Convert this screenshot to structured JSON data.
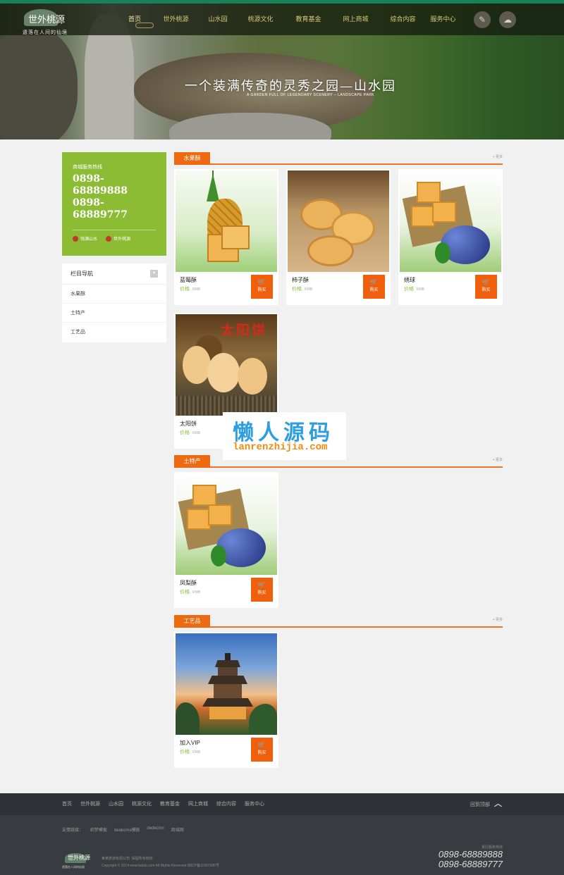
{
  "header": {
    "logo_name": "世外桃源",
    "logo_tagline": "遗落在人间的仙境",
    "nav": [
      "首页",
      "世外桃源",
      "山水园",
      "桃源文化",
      "教育基金",
      "网上商城",
      "综合内容",
      "服务中心"
    ],
    "active_nav": 0
  },
  "banner": {
    "slogan": "一个装满传奇的灵秀之园—山水园",
    "slogan_en": "A GARDEN FULL OF LEGENDARY SCENERY – LANDSCAPE PARK"
  },
  "sidebar": {
    "hotline_label": "商城服务热线",
    "hotline_numbers": [
      "0898-68889888",
      "0898-68889777"
    ],
    "hotline_links": [
      "钱满山水",
      "世外桃源"
    ],
    "category_title": "栏目导航",
    "categories": [
      "水果酥",
      "土特产",
      "工艺品"
    ]
  },
  "sections": [
    {
      "title": "水果酥",
      "more": "+ 更多",
      "items": [
        {
          "name": "蓝莓酥",
          "price_label": "价格",
          "currency": "RMB",
          "buy": "购买"
        },
        {
          "name": "柿子酥",
          "price_label": "价格",
          "currency": "RMB",
          "buy": "购买"
        },
        {
          "name": "绣球",
          "price_label": "价格",
          "currency": "RMB",
          "buy": "购买"
        },
        {
          "name": "太阳饼",
          "price_label": "价格",
          "currency": "RMB",
          "buy": "购买",
          "image_text": "太阳饼"
        }
      ]
    },
    {
      "title": "土特产",
      "more": "+ 更多",
      "items": [
        {
          "name": "凤梨酥",
          "price_label": "价格",
          "currency": "RMB",
          "buy": "购买"
        }
      ]
    },
    {
      "title": "工艺品",
      "more": "+ 更多",
      "items": [
        {
          "name": "加入VIP",
          "price_label": "价格",
          "currency": "RMB",
          "buy": "购买"
        }
      ]
    }
  ],
  "watermark": {
    "cn": "懒人源码",
    "en": "lanrenzhijia.com"
  },
  "footer": {
    "nav": [
      "首页",
      "世外桃源",
      "山水园",
      "桃源文化",
      "教育基金",
      "网上商城",
      "综合内容",
      "服务中心"
    ],
    "back_to_top": "回到顶部",
    "friends_label": "友情链接：",
    "friends": [
      "织梦模板",
      "dedecms模板",
      "dedecms",
      "商城网"
    ],
    "company": "某某旅游有限公司",
    "rights": "保留所有权权",
    "copyright": "Copyright © 2014 www.baidu.com All Rights Reserved 琼ICP备11007585号",
    "hotline_label": "景区服务热线",
    "hotline_numbers": [
      "0898-68889888",
      "0898-68889777"
    ]
  }
}
